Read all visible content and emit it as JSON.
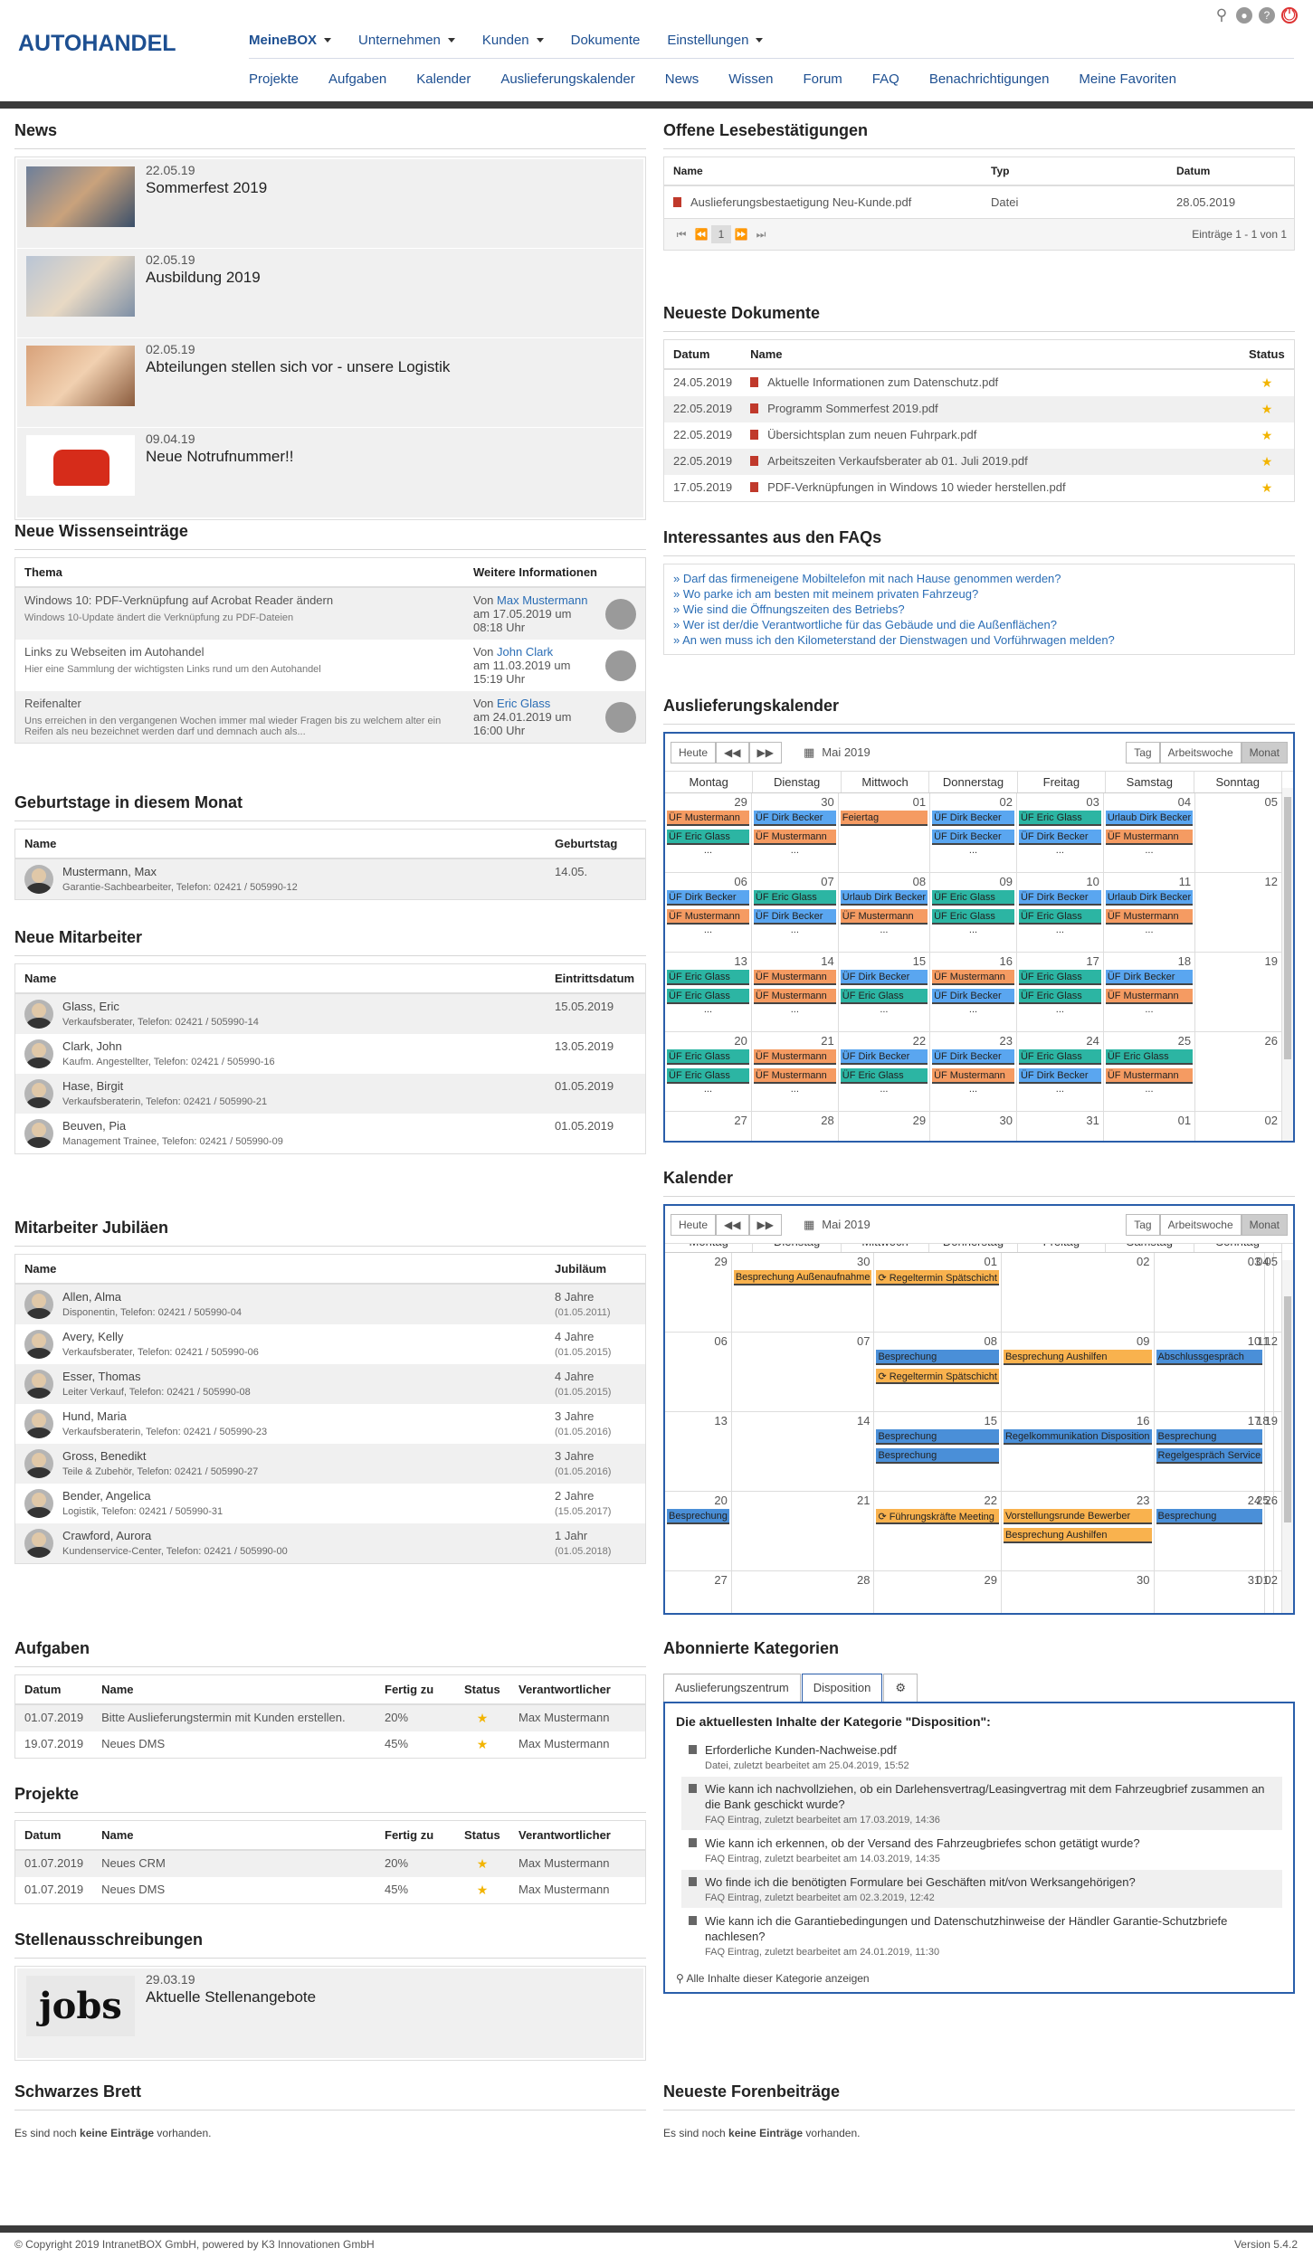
{
  "header": {
    "logo": "AUTOHANDEL",
    "topnav": [
      "MeineBOX",
      "Unternehmen",
      "Kunden",
      "Dokumente",
      "Einstellungen"
    ],
    "subnav": [
      "Projekte",
      "Aufgaben",
      "Kalender",
      "Auslieferungskalender",
      "News",
      "Wissen",
      "Forum",
      "FAQ",
      "Benachrichtigungen",
      "Meine Favoriten"
    ]
  },
  "news": {
    "title": "News",
    "items": [
      {
        "date": "22.05.19",
        "title": "Sommerfest 2019"
      },
      {
        "date": "02.05.19",
        "title": "Ausbildung 2019"
      },
      {
        "date": "02.05.19",
        "title": "Abteilungen stellen sich vor - unsere Logistik"
      },
      {
        "date": "09.04.19",
        "title": "Neue Notrufnummer!!"
      }
    ]
  },
  "wissen": {
    "title": "Neue Wissenseinträge",
    "col1": "Thema",
    "col2": "Weitere Informationen",
    "rows": [
      {
        "t": "Windows 10: PDF-Verknüpfung auf Acrobat Reader ändern",
        "d": "Windows 10-Update ändert die Verknüpfung zu PDF-Dateien",
        "von": "Von",
        "author": "Max Mustermann",
        "date": "am 17.05.2019 um",
        "time": "08:18 Uhr"
      },
      {
        "t": "Links zu Webseiten im Autohandel",
        "d": "Hier eine Sammlung der wichtigsten Links rund um den Autohandel",
        "von": "Von",
        "author": "John Clark",
        "date": "am 11.03.2019 um",
        "time": "15:19 Uhr"
      },
      {
        "t": "Reifenalter",
        "d": "Uns erreichen in den vergangenen Wochen immer mal wieder Fragen bis zu welchem alter ein Reifen als neu bezeichnet werden darf und demnach auch als...",
        "von": "Von",
        "author": "Eric Glass",
        "date": "am 24.01.2019 um",
        "time": "16:00 Uhr"
      }
    ]
  },
  "geburtstage": {
    "title": "Geburtstage in diesem Monat",
    "col1": "Name",
    "col2": "Geburtstag",
    "rows": [
      {
        "name": "Mustermann, Max",
        "sub": "Garantie-Sachbearbeiter, Telefon: 02421 / 505990-12",
        "date": "14.05."
      }
    ]
  },
  "mitarbeiter": {
    "title": "Neue Mitarbeiter",
    "col1": "Name",
    "col2": "Eintrittsdatum",
    "rows": [
      {
        "name": "Glass, Eric",
        "sub": "Verkaufsberater, Telefon: 02421 / 505990-14",
        "date": "15.05.2019"
      },
      {
        "name": "Clark, John",
        "sub": "Kaufm. Angestellter, Telefon: 02421 / 505990-16",
        "date": "13.05.2019"
      },
      {
        "name": "Hase, Birgit",
        "sub": "Verkaufsberaterin, Telefon: 02421 / 505990-21",
        "date": "01.05.2019"
      },
      {
        "name": "Beuven, Pia",
        "sub": "Management Trainee, Telefon: 02421 / 505990-09",
        "date": "01.05.2019"
      }
    ]
  },
  "jubilaeen": {
    "title": "Mitarbeiter Jubiläen",
    "col1": "Name",
    "col2": "Jubiläum",
    "rows": [
      {
        "name": "Allen, Alma",
        "sub": "Disponentin, Telefon: 02421 / 505990-04",
        "years": "8 Jahre",
        "date": "(01.05.2011)"
      },
      {
        "name": "Avery, Kelly",
        "sub": "Verkaufsberater, Telefon: 02421 / 505990-06",
        "years": "4 Jahre",
        "date": "(01.05.2015)"
      },
      {
        "name": "Esser, Thomas",
        "sub": "Leiter Verkauf, Telefon: 02421 / 505990-08",
        "years": "4 Jahre",
        "date": "(01.05.2015)"
      },
      {
        "name": "Hund, Maria",
        "sub": "Verkaufsberaterin, Telefon: 02421 / 505990-23",
        "years": "3 Jahre",
        "date": "(01.05.2016)"
      },
      {
        "name": "Gross, Benedikt",
        "sub": "Teile & Zubehör, Telefon: 02421 / 505990-27",
        "years": "3 Jahre",
        "date": "(01.05.2016)"
      },
      {
        "name": "Bender, Angelica",
        "sub": "Logistik, Telefon: 02421 / 505990-31",
        "years": "2 Jahre",
        "date": "(15.05.2017)"
      },
      {
        "name": "Crawford, Aurora",
        "sub": "Kundenservice-Center, Telefon: 02421 / 505990-00",
        "years": "1 Jahr",
        "date": "(01.05.2018)"
      }
    ]
  },
  "aufgaben": {
    "title": "Aufgaben",
    "cols": [
      "Datum",
      "Name",
      "Fertig zu",
      "Status",
      "Verantwortlicher"
    ],
    "rows": [
      {
        "d": "01.07.2019",
        "n": "Bitte Auslieferungstermin mit Kunden erstellen.",
        "p": "20%",
        "v": "Max Mustermann"
      },
      {
        "d": "19.07.2019",
        "n": "Neues DMS",
        "p": "45%",
        "v": "Max Mustermann"
      }
    ]
  },
  "projekte": {
    "title": "Projekte",
    "cols": [
      "Datum",
      "Name",
      "Fertig zu",
      "Status",
      "Verantwortlicher"
    ],
    "rows": [
      {
        "d": "01.07.2019",
        "n": "Neues CRM",
        "p": "20%",
        "v": "Max Mustermann"
      },
      {
        "d": "01.07.2019",
        "n": "Neues DMS",
        "p": "45%",
        "v": "Max Mustermann"
      }
    ]
  },
  "stellen": {
    "title": "Stellenausschreibungen",
    "date": "29.03.19",
    "item": "Aktuelle Stellenangebote",
    "img": "jobs"
  },
  "brett": {
    "title": "Schwarzes Brett",
    "pre": "Es sind noch ",
    "bold": "keine Einträge",
    "post": " vorhanden."
  },
  "lese": {
    "title": "Offene Lesebestätigungen",
    "cols": [
      "Name",
      "Typ",
      "Datum"
    ],
    "row": {
      "n": "Auslieferungsbestaetigung Neu-Kunde.pdf",
      "t": "Datei",
      "d": "28.05.2019"
    },
    "page": "1",
    "info": "Einträge 1 - 1 von 1"
  },
  "docs": {
    "title": "Neueste Dokumente",
    "cols": [
      "Datum",
      "Name",
      "Status"
    ],
    "rows": [
      {
        "d": "24.05.2019",
        "n": "Aktuelle Informationen zum Datenschutz.pdf"
      },
      {
        "d": "22.05.2019",
        "n": "Programm Sommerfest 2019.pdf"
      },
      {
        "d": "22.05.2019",
        "n": "Übersichtsplan zum neuen Fuhrpark.pdf"
      },
      {
        "d": "22.05.2019",
        "n": "Arbeitszeiten Verkaufsberater ab 01. Juli 2019.pdf"
      },
      {
        "d": "17.05.2019",
        "n": "PDF-Verknüpfungen in Windows 10 wieder herstellen.pdf"
      }
    ]
  },
  "faq": {
    "title": "Interessantes aus den FAQs",
    "items": [
      "» Darf das firmeneigene Mobiltelefon mit nach Hause genommen werden?",
      "» Wo parke ich am besten mit meinem privaten Fahrzeug?",
      "» Wie sind die Öffnungszeiten des Betriebs?",
      "» Wer ist der/die Verantwortliche für das Gebäude und die Außenflächen?",
      "» An wen muss ich den Kilometerstand der Dienstwagen und Vorführwagen melden?"
    ]
  },
  "cal1": {
    "title": "Auslieferungskalender",
    "today": "Heute",
    "month": "Mai 2019",
    "views": [
      "Tag",
      "Arbeitswoche",
      "Monat"
    ],
    "days": [
      "Montag",
      "Dienstag",
      "Mittwoch",
      "Donnerstag",
      "Freitag",
      "Samstag",
      "Sonntag"
    ],
    "weeks": [
      [
        {
          "n": "29",
          "e": [
            [
              "or",
              "ÜF Mustermann"
            ],
            [
              "gr",
              "ÜF Eric Glass"
            ]
          ],
          "m": true
        },
        {
          "n": "30",
          "e": [
            [
              "bl",
              "ÜF Dirk Becker"
            ],
            [
              "or",
              "ÜF Mustermann"
            ]
          ],
          "m": true
        },
        {
          "n": "01",
          "e": [
            [
              "or",
              "Feiertag"
            ]
          ],
          "m": false
        },
        {
          "n": "02",
          "e": [
            [
              "bl",
              "ÜF Dirk Becker"
            ],
            [
              "bl",
              "ÜF Dirk Becker"
            ]
          ],
          "m": true
        },
        {
          "n": "03",
          "e": [
            [
              "gr",
              "ÜF Eric Glass"
            ],
            [
              "bl",
              "ÜF Dirk Becker"
            ]
          ],
          "m": true
        },
        {
          "n": "04",
          "e": [
            [
              "bl",
              "Urlaub Dirk Becker"
            ],
            [
              "or",
              "ÜF Mustermann"
            ]
          ],
          "m": true
        },
        {
          "n": "05",
          "e": [],
          "m": false
        }
      ],
      [
        {
          "n": "06",
          "e": [
            [
              "bl",
              "ÜF Dirk Becker"
            ],
            [
              "or",
              "ÜF Mustermann"
            ]
          ],
          "m": true
        },
        {
          "n": "07",
          "e": [
            [
              "gr",
              "ÜF Eric Glass"
            ],
            [
              "bl",
              "ÜF Dirk Becker"
            ]
          ],
          "m": true
        },
        {
          "n": "08",
          "e": [
            [
              "bl",
              "Urlaub Dirk Becker"
            ],
            [
              "or",
              "ÜF Mustermann"
            ]
          ],
          "m": true
        },
        {
          "n": "09",
          "e": [
            [
              "gr",
              "ÜF Eric Glass"
            ],
            [
              "gr",
              "ÜF Eric Glass"
            ]
          ],
          "m": true
        },
        {
          "n": "10",
          "e": [
            [
              "bl",
              "ÜF Dirk Becker"
            ],
            [
              "gr",
              "ÜF Eric Glass"
            ]
          ],
          "m": true
        },
        {
          "n": "11",
          "e": [
            [
              "bl",
              "Urlaub Dirk Becker"
            ],
            [
              "or",
              "ÜF Mustermann"
            ]
          ],
          "m": true
        },
        {
          "n": "12",
          "e": [],
          "m": false
        }
      ],
      [
        {
          "n": "13",
          "e": [
            [
              "gr",
              "ÜF Eric Glass"
            ],
            [
              "gr",
              "ÜF Eric Glass"
            ]
          ],
          "m": true
        },
        {
          "n": "14",
          "e": [
            [
              "or",
              "ÜF Mustermann"
            ],
            [
              "or",
              "ÜF Mustermann"
            ]
          ],
          "m": true
        },
        {
          "n": "15",
          "e": [
            [
              "bl",
              "ÜF Dirk Becker"
            ],
            [
              "gr",
              "ÜF Eric Glass"
            ]
          ],
          "m": true
        },
        {
          "n": "16",
          "e": [
            [
              "or",
              "ÜF Mustermann"
            ],
            [
              "bl",
              "ÜF Dirk Becker"
            ]
          ],
          "m": true
        },
        {
          "n": "17",
          "e": [
            [
              "gr",
              "ÜF Eric Glass"
            ],
            [
              "gr",
              "ÜF Eric Glass"
            ]
          ],
          "m": true
        },
        {
          "n": "18",
          "e": [
            [
              "bl",
              "ÜF Dirk Becker"
            ],
            [
              "or",
              "ÜF Mustermann"
            ]
          ],
          "m": true
        },
        {
          "n": "19",
          "e": [],
          "m": false
        }
      ],
      [
        {
          "n": "20",
          "e": [
            [
              "gr",
              "ÜF Eric Glass"
            ],
            [
              "gr",
              "ÜF Eric Glass"
            ]
          ],
          "m": true
        },
        {
          "n": "21",
          "e": [
            [
              "or",
              "ÜF Mustermann"
            ],
            [
              "or",
              "ÜF Mustermann"
            ]
          ],
          "m": true
        },
        {
          "n": "22",
          "e": [
            [
              "bl",
              "ÜF Dirk Becker"
            ],
            [
              "gr",
              "ÜF Eric Glass"
            ]
          ],
          "m": true
        },
        {
          "n": "23",
          "e": [
            [
              "bl",
              "ÜF Dirk Becker"
            ],
            [
              "or",
              "ÜF Mustermann"
            ]
          ],
          "m": true
        },
        {
          "n": "24",
          "e": [
            [
              "gr",
              "ÜF Eric Glass"
            ],
            [
              "bl",
              "ÜF Dirk Becker"
            ]
          ],
          "m": true
        },
        {
          "n": "25",
          "e": [
            [
              "gr",
              "ÜF Eric Glass"
            ],
            [
              "or",
              "ÜF Mustermann"
            ]
          ],
          "m": true
        },
        {
          "n": "26",
          "e": [],
          "m": false
        }
      ],
      [
        {
          "n": "27",
          "e": [],
          "m": false
        },
        {
          "n": "28",
          "e": [],
          "m": false
        },
        {
          "n": "29",
          "e": [],
          "m": false
        },
        {
          "n": "30",
          "e": [],
          "m": false
        },
        {
          "n": "31",
          "e": [],
          "m": false
        },
        {
          "n": "01",
          "e": [],
          "m": false
        },
        {
          "n": "02",
          "e": [],
          "m": false
        }
      ]
    ]
  },
  "cal2": {
    "title": "Kalender",
    "today": "Heute",
    "month": "Mai 2019",
    "views": [
      "Tag",
      "Arbeitswoche",
      "Monat"
    ],
    "days": [
      "Montag",
      "Dienstag",
      "Mittwoch",
      "Donnerstag",
      "Freitag",
      "Samstag",
      "Sonntag"
    ],
    "weeks": [
      [
        {
          "n": "29",
          "e": []
        },
        {
          "n": "30",
          "e": [
            [
              "yl",
              "Besprechung Außenaufnahme"
            ]
          ]
        },
        {
          "n": "01",
          "e": [
            [
              "yl",
              "⟳ Regeltermin Spätschicht"
            ]
          ]
        },
        {
          "n": "02",
          "e": []
        },
        {
          "n": "03",
          "e": []
        },
        {
          "n": "04",
          "e": []
        },
        {
          "n": "05",
          "e": []
        }
      ],
      [
        {
          "n": "06",
          "e": []
        },
        {
          "n": "07",
          "e": []
        },
        {
          "n": "08",
          "e": [
            [
              "sb",
              "Besprechung"
            ],
            [
              "yl",
              "⟳ Regeltermin Spätschicht"
            ]
          ]
        },
        {
          "n": "09",
          "e": [
            [
              "yl",
              "Besprechung Aushilfen"
            ]
          ]
        },
        {
          "n": "10",
          "e": [
            [
              "sb",
              "Abschlussgespräch"
            ]
          ]
        },
        {
          "n": "11",
          "e": []
        },
        {
          "n": "12",
          "e": []
        }
      ],
      [
        {
          "n": "13",
          "e": []
        },
        {
          "n": "14",
          "e": []
        },
        {
          "n": "15",
          "e": [
            [
              "sb",
              "Besprechung"
            ],
            [
              "sb",
              "Besprechung"
            ]
          ]
        },
        {
          "n": "16",
          "e": [
            [
              "sb",
              "Regelkommunikation Disposition"
            ]
          ]
        },
        {
          "n": "17",
          "e": [
            [
              "sb",
              "Besprechung"
            ],
            [
              "sb",
              "Regelgespräch Service"
            ]
          ]
        },
        {
          "n": "18",
          "e": []
        },
        {
          "n": "19",
          "e": []
        }
      ],
      [
        {
          "n": "20",
          "e": [
            [
              "sb",
              "Besprechung"
            ]
          ]
        },
        {
          "n": "21",
          "e": []
        },
        {
          "n": "22",
          "e": [
            [
              "yl",
              "⟳ Führungskräfte Meeting"
            ]
          ]
        },
        {
          "n": "23",
          "e": [
            [
              "yl",
              "Vorstellungsrunde Bewerber"
            ],
            [
              "yl",
              "Besprechung Aushilfen"
            ]
          ]
        },
        {
          "n": "24",
          "e": [
            [
              "sb",
              "Besprechung"
            ]
          ]
        },
        {
          "n": "25",
          "e": []
        },
        {
          "n": "26",
          "e": []
        }
      ],
      [
        {
          "n": "27",
          "e": []
        },
        {
          "n": "28",
          "e": []
        },
        {
          "n": "29",
          "e": []
        },
        {
          "n": "30",
          "e": []
        },
        {
          "n": "31",
          "e": []
        },
        {
          "n": "01",
          "e": []
        },
        {
          "n": "02",
          "e": []
        }
      ]
    ]
  },
  "kategorien": {
    "title": "Abonnierte Kategorien",
    "tabs": [
      "Auslieferungszentrum",
      "Disposition"
    ],
    "heading": "Die aktuellesten Inhalte der Kategorie \"Disposition\":",
    "items": [
      {
        "t": "Erforderliche Kunden-Nachweise.pdf",
        "m": "Datei, zuletzt bearbeitet am 25.04.2019, 15:52"
      },
      {
        "t": "Wie kann ich nachvollziehen, ob ein Darlehensvertrag/Leasingvertrag mit dem Fahrzeugbrief zusammen an die Bank geschickt wurde?",
        "m": "FAQ Eintrag, zuletzt bearbeitet am 17.03.2019, 14:36"
      },
      {
        "t": "Wie kann ich erkennen, ob der Versand des Fahrzeugbriefes schon getätigt wurde?",
        "m": "FAQ Eintrag, zuletzt bearbeitet am 14.03.2019, 14:35"
      },
      {
        "t": "Wo finde ich die benötigten Formulare bei Geschäften mit/von Werksangehörigen?",
        "m": "FAQ Eintrag, zuletzt bearbeitet am 02.3.2019, 12:42"
      },
      {
        "t": "Wie kann ich die Garantiebedingungen und Datenschutzhinweise der Händler Garantie-Schutzbriefe nachlesen?",
        "m": "FAQ Eintrag, zuletzt bearbeitet am 24.01.2019, 11:30"
      }
    ],
    "all": "Alle Inhalte dieser Kategorie anzeigen"
  },
  "forum": {
    "title": "Neueste Forenbeiträge",
    "pre": "Es sind noch ",
    "bold": "keine Einträge",
    "post": " vorhanden."
  },
  "footer": {
    "copy": "© Copyright 2019 IntranetBOX GmbH, powered by K3 Innovationen GmbH",
    "version": "Version 5.4.2"
  }
}
